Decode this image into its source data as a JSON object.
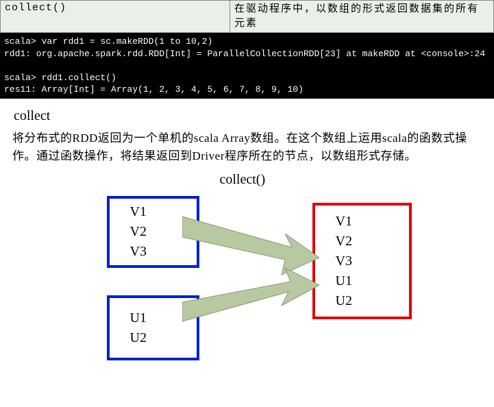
{
  "header": {
    "method": "collect()",
    "desc": "在驱动程序中，以数组的形式返回数据集的所有元素"
  },
  "terminal": {
    "line1": "scala> var rdd1 = sc.makeRDD(1 to 10,2)",
    "line2": "rdd1: org.apache.spark.rdd.RDD[Int] = ParallelCollectionRDD[23] at makeRDD at <console>:24",
    "blank": "",
    "line3": "scala> rdd1.collect()",
    "line4": "res11: Array[Int] = Array(1, 2, 3, 4, 5, 6, 7, 8, 9, 10)"
  },
  "section": {
    "title": "collect",
    "para": "将分布式的RDD返回为一个单机的scala Array数组。在这个数组上运用scala的函数式操作。通过函数操作，将结果返回到Driver程序所在的节点，以数组形式存储。"
  },
  "diagram": {
    "label": "collect()",
    "box1": {
      "v1": "V1",
      "v2": "V2",
      "v3": "V3"
    },
    "box2": {
      "u1": "U1",
      "u2": "U2"
    },
    "result": {
      "r1": "V1",
      "r2": "V2",
      "r3": "V3",
      "r4": "U1",
      "r5": "U2"
    }
  }
}
